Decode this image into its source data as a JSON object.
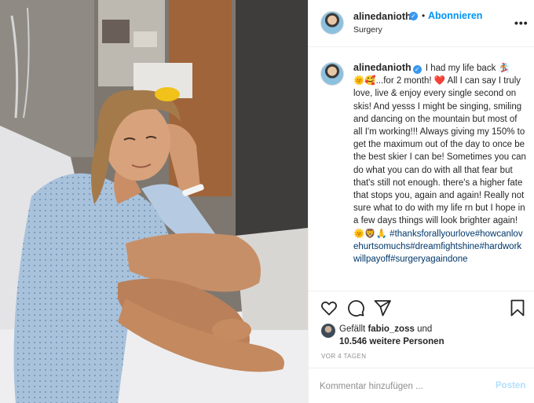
{
  "post": {
    "username": "alinedanioth",
    "verified_icon": "verified-badge-icon",
    "separator": "•",
    "follow_label": "Abonnieren",
    "location": "Surgery",
    "more_icon": "more-options-icon"
  },
  "caption": {
    "username": "alinedanioth",
    "part1": "I had my life back ",
    "emoji1": "🏂",
    "emoji2": "🌞🥰",
    "part2": "...for 2 month! ",
    "emoji3": "❤️",
    "part3": " All I can say I truly love, live & enjoy every single second on skis! And yesss I might be singing, smiling and dancing on the mountain but most of all I'm working!!! Always giving my 150% to get the maximum out of the day to once be the best skier I can be! Sometimes you can do what you can do with all that fear but that's still not enough. there's a higher fate that stops you, again and again! Really not sure what to do with my life rn but I hope in a few days things will look brighter again! ",
    "emoji4": "🌞🦁🙏",
    "hashtags": "#thanksforallyourlove#howcanlovehurtsomuchs#dreamfightshine#hardworkwillpayoff#surgeryagaindone"
  },
  "actions": {
    "like": "heart-icon",
    "comment": "comment-icon",
    "share": "share-icon",
    "save": "bookmark-icon"
  },
  "likes": {
    "prefix": "Gefällt ",
    "liker": "fabio_zoss",
    "and": " und",
    "count": "10.546 weitere Personen"
  },
  "timestamp": "VOR 4 TAGEN",
  "comment_box": {
    "placeholder": "Kommentar hinzufügen ...",
    "post_label": "Posten"
  },
  "colors": {
    "accent": "#0095f6",
    "verified": "#3897f0",
    "hashtag": "#00376b",
    "post_disabled": "#b2dffc"
  }
}
